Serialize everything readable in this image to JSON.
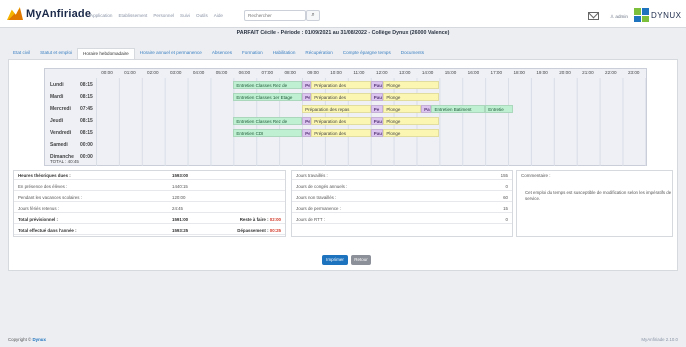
{
  "app": {
    "brand": "MyAnfiriade",
    "menu": [
      "Application",
      "Etablissement",
      "Personnel",
      "Suivi",
      "Outils",
      "Aide"
    ],
    "search": {
      "placeholder": "Rechercher"
    },
    "user": "admin",
    "partner": "DYNUX"
  },
  "page": {
    "title": "PARFAIT Cécile - Période : 01/09/2021 au 31/08/2022 - Collège Dynux (26000 Valence)"
  },
  "tabs": [
    {
      "label": "Etat civil",
      "active": false
    },
    {
      "label": "Statut et emploi",
      "active": false
    },
    {
      "label": "Horaire hebdomadaire",
      "active": true
    },
    {
      "label": "Horaire annuel et permanence",
      "active": false
    },
    {
      "label": "Absences",
      "active": false
    },
    {
      "label": "Formation",
      "active": false
    },
    {
      "label": "Habilitation",
      "active": false
    },
    {
      "label": "Récupération",
      "active": false
    },
    {
      "label": "Compte épargne temps",
      "active": false
    },
    {
      "label": "Documents",
      "active": false
    }
  ],
  "planning": {
    "hours": [
      "00:00",
      "01:00",
      "02:00",
      "03:00",
      "04:00",
      "05:00",
      "06:00",
      "07:00",
      "08:00",
      "09:00",
      "10:00",
      "11:00",
      "12:00",
      "13:00",
      "14:00",
      "15:00",
      "16:00",
      "17:00",
      "18:00",
      "19:00",
      "20:00",
      "21:00",
      "22:00",
      "23:00"
    ],
    "days": [
      {
        "day": "Lundi",
        "total": "08:15",
        "blocks": [
          {
            "start": 6,
            "end": 9,
            "label": "Entretien Classes Rez de",
            "color": "green"
          },
          {
            "start": 9,
            "end": 9.4,
            "label": "Pe",
            "color": "purple"
          },
          {
            "start": 9.4,
            "end": 12,
            "label": "Préparation des",
            "color": "yellow"
          },
          {
            "start": 12,
            "end": 12.55,
            "label": "Pau",
            "color": "purple"
          },
          {
            "start": 12.55,
            "end": 15,
            "label": "Plonge",
            "color": "yellow"
          }
        ]
      },
      {
        "day": "Mardi",
        "total": "08:15",
        "blocks": [
          {
            "start": 6,
            "end": 9,
            "label": "Entretien Classes 1er Etage",
            "color": "green"
          },
          {
            "start": 9,
            "end": 9.4,
            "label": "Pe",
            "color": "purple"
          },
          {
            "start": 9.4,
            "end": 12,
            "label": "Préparation des",
            "color": "yellow"
          },
          {
            "start": 12,
            "end": 12.55,
            "label": "Pau",
            "color": "purple"
          },
          {
            "start": 12.55,
            "end": 15,
            "label": "Plonge",
            "color": "yellow"
          }
        ]
      },
      {
        "day": "Mercredi",
        "total": "07:45",
        "blocks": [
          {
            "start": 9,
            "end": 12,
            "label": "Préparation des repas",
            "color": "yellow"
          },
          {
            "start": 12,
            "end": 12.55,
            "label": "Pe",
            "color": "purple"
          },
          {
            "start": 12.55,
            "end": 14.2,
            "label": "Plonge",
            "color": "yellow"
          },
          {
            "start": 14.2,
            "end": 14.65,
            "label": "Pau",
            "color": "purple"
          },
          {
            "start": 14.65,
            "end": 17,
            "label": "Entretien Batiment",
            "color": "green"
          },
          {
            "start": 17,
            "end": 18.2,
            "label": "Entretie",
            "color": "green"
          }
        ]
      },
      {
        "day": "Jeudi",
        "total": "08:15",
        "blocks": [
          {
            "start": 6,
            "end": 9,
            "label": "Entretien Classes Rez de",
            "color": "green"
          },
          {
            "start": 9,
            "end": 9.4,
            "label": "Pe",
            "color": "purple"
          },
          {
            "start": 9.4,
            "end": 12,
            "label": "Préparation des",
            "color": "yellow"
          },
          {
            "start": 12,
            "end": 12.55,
            "label": "Pau",
            "color": "purple"
          },
          {
            "start": 12.55,
            "end": 15,
            "label": "Plonge",
            "color": "yellow"
          }
        ]
      },
      {
        "day": "Vendredi",
        "total": "08:15",
        "blocks": [
          {
            "start": 6,
            "end": 9,
            "label": "Entretien CDI",
            "color": "green"
          },
          {
            "start": 9,
            "end": 9.4,
            "label": "Pe",
            "color": "purple"
          },
          {
            "start": 9.4,
            "end": 12,
            "label": "Préparation des",
            "color": "yellow"
          },
          {
            "start": 12,
            "end": 12.55,
            "label": "Pau",
            "color": "purple"
          },
          {
            "start": 12.55,
            "end": 15,
            "label": "Plonge",
            "color": "yellow"
          }
        ]
      },
      {
        "day": "Samedi",
        "total": "00:00",
        "blocks": []
      },
      {
        "day": "Dimanche",
        "total": "00:00",
        "blocks": []
      }
    ],
    "total": "TOTAL : 40:45"
  },
  "summary_left": {
    "rows": [
      {
        "label": "Heures théoriques dues :",
        "value": "1593:00",
        "bold": true
      },
      {
        "label": "En présence des élèves :",
        "value": "1440:15",
        "bold": false
      },
      {
        "label": "Pendant les vacances scolaires :",
        "value": "120:00",
        "bold": false
      },
      {
        "label": "Jours fériés retenus :",
        "value": "24:45",
        "bold": false
      },
      {
        "label": "Total prévisionnel :",
        "value": "1591:00",
        "bold": true,
        "extra_label": "Reste à faire :",
        "extra_value": "02:00"
      },
      {
        "label": "Total effectué dans l'année :",
        "value": "1593:25",
        "bold": true,
        "extra_label": "Dépassement :",
        "extra_value": "00:25"
      }
    ]
  },
  "summary_mid": {
    "rows": [
      {
        "label": "Jours travaillés :",
        "value": "155"
      },
      {
        "label": "Jours de congés annuels :",
        "value": "0"
      },
      {
        "label": "Jours non travaillés :",
        "value": "60"
      },
      {
        "label": "Jours de permanence :",
        "value": "15"
      },
      {
        "label": "Jours de RTT :",
        "value": "0"
      }
    ]
  },
  "comment": {
    "title": "Commentaire :",
    "text": "Cet emploi du temps est susceptible de modification selon les impératifs de service."
  },
  "buttons": {
    "print": "Imprimer",
    "back": "Retour"
  },
  "footer": {
    "copyright": "Copyright ©",
    "company": "Dynux",
    "version": "MyAnfiriade 2.10.0"
  }
}
